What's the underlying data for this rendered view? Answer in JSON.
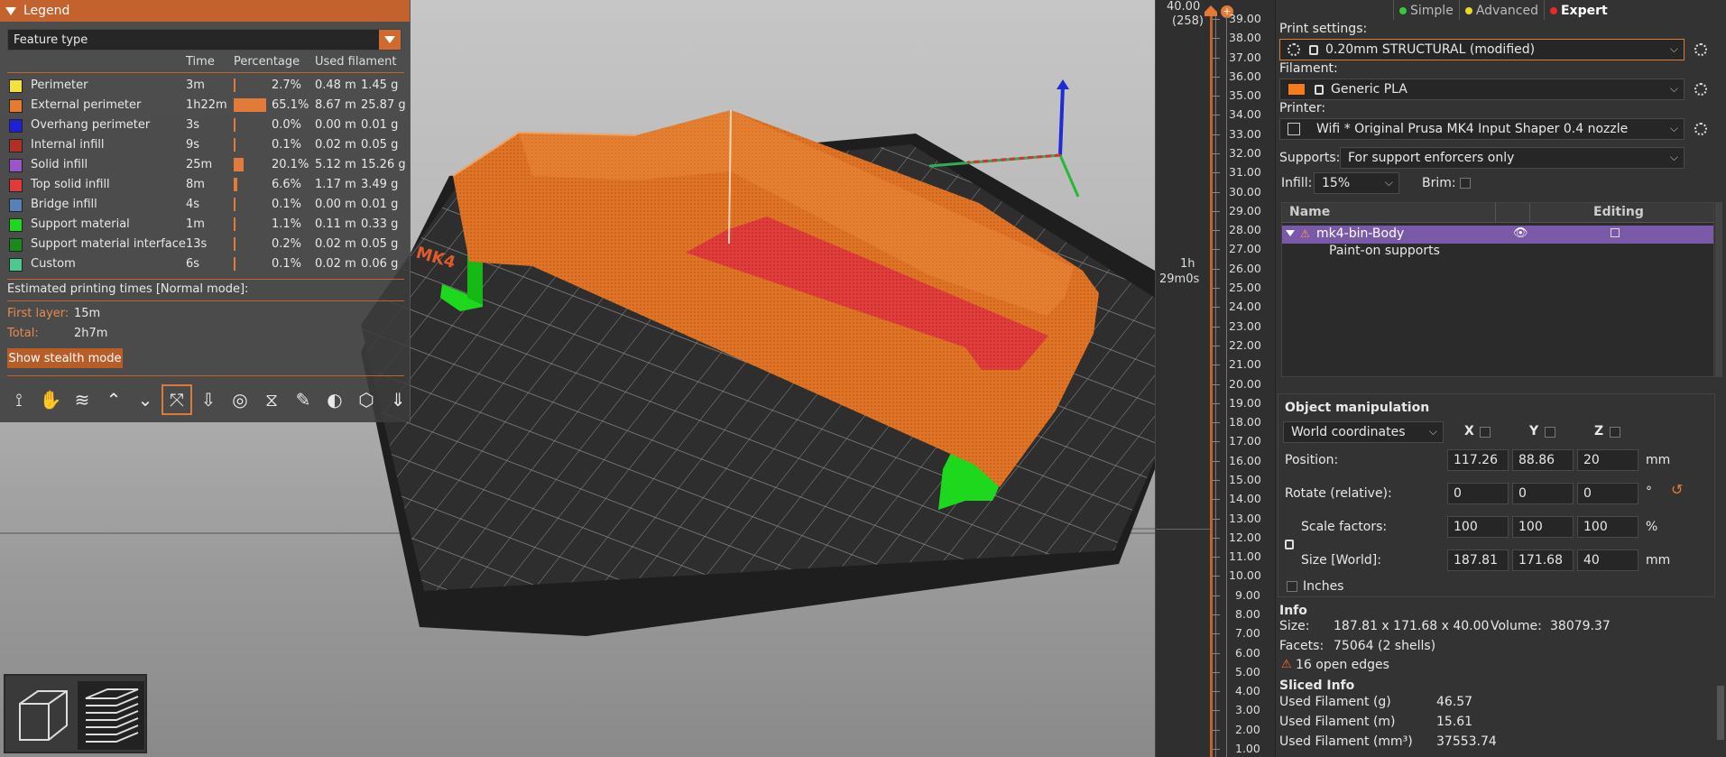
{
  "legend": {
    "title": "Legend",
    "view_type": "Feature type",
    "columns": {
      "time": "Time",
      "percentage": "Percentage",
      "used_filament": "Used filament"
    },
    "rows": [
      {
        "label": "Perimeter",
        "color": "#f2e23a",
        "time": "3m",
        "pct": "2.7%",
        "pct_value": 2.7,
        "m": "0.48 m",
        "g": "1.45 g"
      },
      {
        "label": "External perimeter",
        "color": "#e87a30",
        "time": "1h22m",
        "pct": "65.1%",
        "pct_value": 65.1,
        "m": "8.67 m",
        "g": "25.87 g"
      },
      {
        "label": "Overhang perimeter",
        "color": "#1f1fd6",
        "time": "3s",
        "pct": "0.0%",
        "pct_value": 0.0,
        "m": "0.00 m",
        "g": "0.01 g"
      },
      {
        "label": "Internal infill",
        "color": "#b03028",
        "time": "9s",
        "pct": "0.1%",
        "pct_value": 0.1,
        "m": "0.02 m",
        "g": "0.05 g"
      },
      {
        "label": "Solid infill",
        "color": "#9a55c8",
        "time": "25m",
        "pct": "20.1%",
        "pct_value": 20.1,
        "m": "5.12 m",
        "g": "15.26 g"
      },
      {
        "label": "Top solid infill",
        "color": "#e23a3a",
        "time": "8m",
        "pct": "6.6%",
        "pct_value": 6.6,
        "m": "1.17 m",
        "g": "3.49 g"
      },
      {
        "label": "Bridge infill",
        "color": "#5a80b8",
        "time": "4s",
        "pct": "0.1%",
        "pct_value": 0.1,
        "m": "0.00 m",
        "g": "0.01 g"
      },
      {
        "label": "Support material",
        "color": "#1ed81e",
        "time": "1m",
        "pct": "1.1%",
        "pct_value": 1.1,
        "m": "0.11 m",
        "g": "0.33 g"
      },
      {
        "label": "Support material interface",
        "color": "#1a8a1a",
        "time": "13s",
        "pct": "0.2%",
        "pct_value": 0.2,
        "m": "0.02 m",
        "g": "0.05 g"
      },
      {
        "label": "Custom",
        "color": "#4fc890",
        "time": "6s",
        "pct": "0.1%",
        "pct_value": 0.1,
        "m": "0.02 m",
        "g": "0.06 g"
      }
    ],
    "estimated_label": "Estimated printing times [Normal mode]:",
    "first_layer_label": "First layer:",
    "first_layer_value": "15m",
    "total_label": "Total:",
    "total_value": "2h7m",
    "stealth_button": "Show stealth mode"
  },
  "vslider": {
    "top_value": "40.00",
    "top_layer": "(258)",
    "time_line1": "1h",
    "time_line2": "29m0s",
    "ticks": [
      "39.00",
      "38.00",
      "37.00",
      "36.00",
      "35.00",
      "34.00",
      "33.00",
      "32.00",
      "31.00",
      "30.00",
      "29.00",
      "28.00",
      "27.00",
      "26.00",
      "25.00",
      "24.00",
      "23.00",
      "22.00",
      "21.00",
      "20.00",
      "19.00",
      "18.00",
      "17.00",
      "16.00",
      "15.00",
      "14.00",
      "13.00",
      "12.00",
      "11.00",
      "10.00",
      "9.00",
      "8.00",
      "7.00",
      "6.00",
      "5.00",
      "4.00",
      "3.00",
      "2.00",
      "1.00"
    ]
  },
  "modes": {
    "simple": "Simple",
    "advanced": "Advanced",
    "expert": "Expert"
  },
  "print_settings": {
    "label": "Print settings:",
    "value": "0.20mm STRUCTURAL (modified)"
  },
  "filament": {
    "label": "Filament:",
    "value": "Generic PLA",
    "color": "#f57c1a"
  },
  "printer": {
    "label": "Printer:",
    "value": "Wifi * Original Prusa MK4 Input Shaper 0.4 nozzle"
  },
  "supports": {
    "label": "Supports:",
    "value": "For support enforcers only"
  },
  "infill": {
    "label": "Infill:",
    "value": "15%"
  },
  "brim": {
    "label": "Brim:"
  },
  "object_list": {
    "col_name": "Name",
    "col_editing": "Editing",
    "object_name": "mk4-bin-Body",
    "child": "Paint-on supports"
  },
  "manipulation": {
    "title": "Object manipulation",
    "coords": "World coordinates",
    "x": "X",
    "y": "Y",
    "z": "Z",
    "position_label": "Position:",
    "position": [
      "117.26",
      "88.86",
      "20"
    ],
    "position_unit": "mm",
    "rotate_label": "Rotate (relative):",
    "rotate": [
      "0",
      "0",
      "0"
    ],
    "rotate_unit": "°",
    "scale_label": "Scale factors:",
    "scale": [
      "100",
      "100",
      "100"
    ],
    "scale_unit": "%",
    "size_label": "Size [World]:",
    "size": [
      "187.81",
      "171.68",
      "40"
    ],
    "size_unit": "mm",
    "inches_label": "Inches"
  },
  "info": {
    "title": "Info",
    "size_label": "Size:",
    "size_value": "187.81 x 171.68 x 40.00",
    "volume_label": "Volume:",
    "volume_value": "38079.37",
    "facets_label": "Facets:",
    "facets_value": "75064 (2 shells)",
    "open_edges": "16 open edges"
  },
  "sliced_info": {
    "title": "Sliced Info",
    "rows": [
      {
        "label": "Used Filament (g)",
        "value": "46.57"
      },
      {
        "label": "Used Filament (m)",
        "value": "15.61"
      },
      {
        "label": "Used Filament (mm³)",
        "value": "37553.74"
      }
    ]
  },
  "bed_label": "MK4"
}
